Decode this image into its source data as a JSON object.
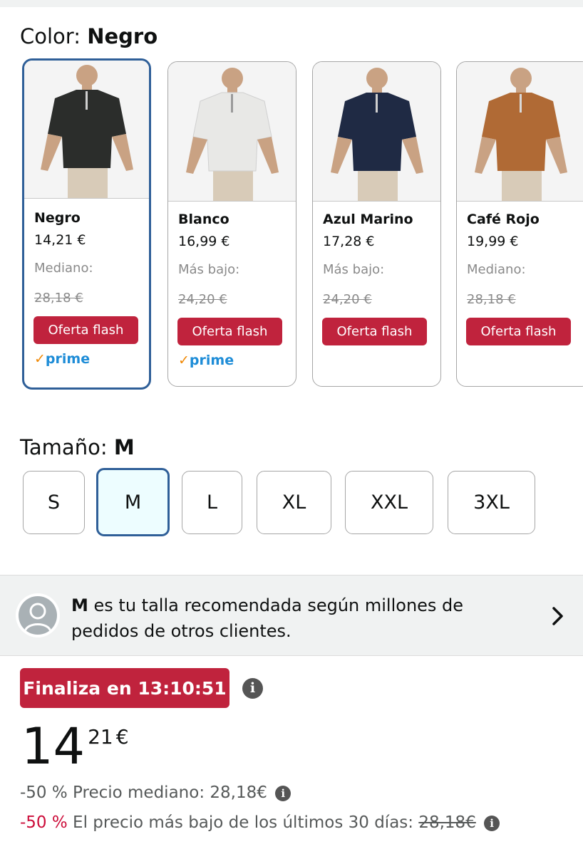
{
  "color_selector": {
    "label": "Color:",
    "selected": "Negro",
    "options": [
      {
        "name": "Negro",
        "price": "14,21 €",
        "ref_label": "Mediano:",
        "ref_price": "28,18 €",
        "deal": "Oferta flash",
        "prime": "prime",
        "shirt_color": "#2b2d2b"
      },
      {
        "name": "Blanco",
        "price": "16,99 €",
        "ref_label": "Más bajo:",
        "ref_price": "24,20 €",
        "deal": "Oferta flash",
        "prime": "prime",
        "shirt_color": "#e8e8e6"
      },
      {
        "name": "Azul Marino",
        "price": "17,28 €",
        "ref_label": "Más bajo:",
        "ref_price": "24,20 €",
        "deal": "Oferta flash",
        "prime": "",
        "shirt_color": "#1f2a44"
      },
      {
        "name": "Café Rojo",
        "price": "19,99 €",
        "ref_label": "Mediano:",
        "ref_price": "28,18 €",
        "deal": "Oferta flash",
        "prime": "",
        "shirt_color": "#b06a35"
      }
    ]
  },
  "size_selector": {
    "label": "Tamaño:",
    "selected": "M",
    "options": [
      "S",
      "M",
      "L",
      "XL",
      "XXL",
      "3XL"
    ]
  },
  "size_recommendation": {
    "size": "M",
    "text": "es tu talla recomendada según millones de pedidos de otros clientes.",
    "avatar_icon": "user-avatar-icon",
    "chevron_icon": "chevron-right-icon"
  },
  "deal_timer": {
    "text": "Finaliza en 13:10:51",
    "info_icon": "info-icon"
  },
  "price": {
    "whole": "14",
    "fraction": "21",
    "currency": "€"
  },
  "price_notes": {
    "line1_discount": "-50 %",
    "line1_text": "Precio mediano: 28,18€",
    "line2_discount": "-50 %",
    "line2_text": "El precio más bajo de los últimos 30 días:",
    "line2_strike": "28,18€"
  },
  "colors": {
    "deal_red": "#c0233d",
    "selection_blue": "#2f5f98",
    "discount_red": "#cc0c39",
    "prime_blue": "#1d8cd7",
    "prime_orange": "#f08804"
  }
}
